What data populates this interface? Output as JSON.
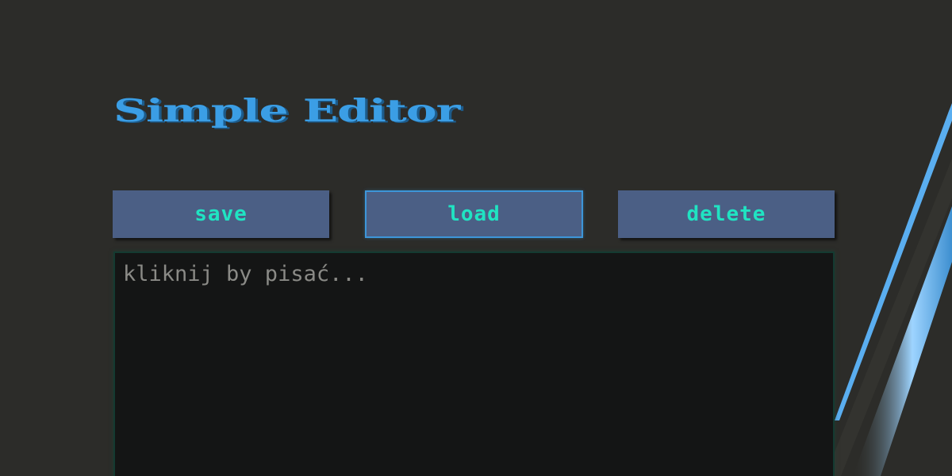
{
  "app": {
    "title": "Simple Editor"
  },
  "toolbar": {
    "save_label": "save",
    "load_label": "load",
    "delete_label": "delete"
  },
  "editor": {
    "value": "",
    "placeholder": "kliknij by pisać..."
  },
  "colors": {
    "background": "#2c2c29",
    "title": "#3b9ee5",
    "button_bg": "#4b5f85",
    "button_text": "#20e3c2",
    "button_focus_border": "#3d96d9",
    "editor_bg": "#141515",
    "placeholder": "#8a8a86",
    "accent_stripe": "#5aaef0"
  }
}
